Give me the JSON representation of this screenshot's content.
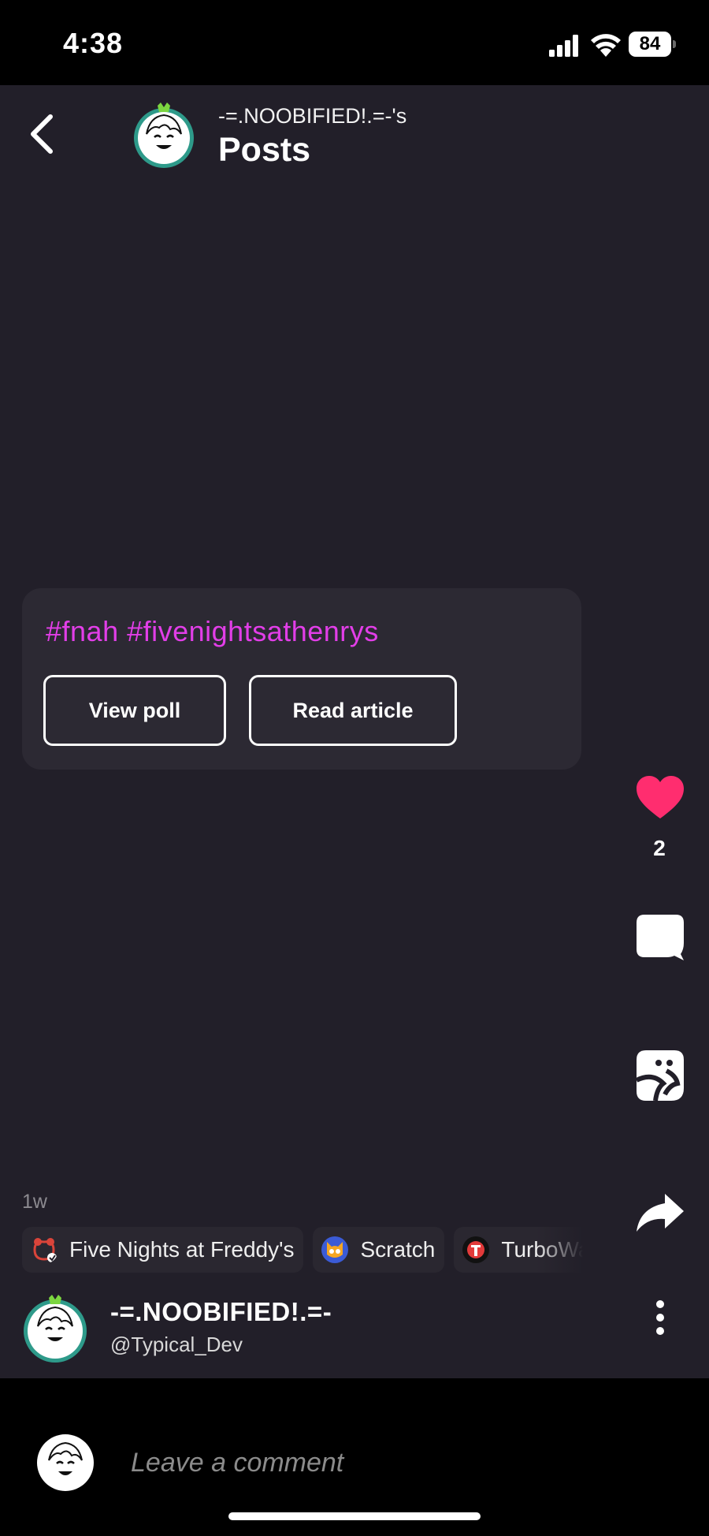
{
  "status_bar": {
    "time": "4:38",
    "battery": "84",
    "icons": [
      "signal-icon",
      "wifi-icon",
      "battery-icon"
    ]
  },
  "header": {
    "subtitle": "-=.NOOBIFIED!.=-'s",
    "title": "Posts",
    "icons": [
      "back-chevron-icon",
      "avatar-icon"
    ]
  },
  "post": {
    "hashtags": "#fnah #fivenightsathenrys",
    "buttons": {
      "view_poll": "View poll",
      "read_article": "Read article"
    },
    "time_ago": "1w",
    "like_count": "2",
    "action_icons": [
      "heart-icon",
      "comment-bubble-icon",
      "sticker-icon",
      "share-arrow-icon"
    ],
    "communities": [
      {
        "name": "Five Nights at Freddy's",
        "icon": "freddy-community-icon",
        "color": "#d9443a"
      },
      {
        "name": "Scratch",
        "icon": "scratch-cat-icon",
        "color": "#f5a623"
      },
      {
        "name": "TurboWarp",
        "icon": "turbowarp-icon",
        "color": "#e23a3a"
      }
    ]
  },
  "author": {
    "name": "-=.NOOBIFIED!.=-",
    "handle": "@Typical_Dev"
  },
  "comment_bar": {
    "placeholder": "Leave a comment"
  },
  "colors": {
    "background": "#221f29",
    "card": "#2c2933",
    "hashtag": "#e23ee8",
    "like": "#ff2d6f",
    "avatar_ring": "#2e9a8a"
  }
}
